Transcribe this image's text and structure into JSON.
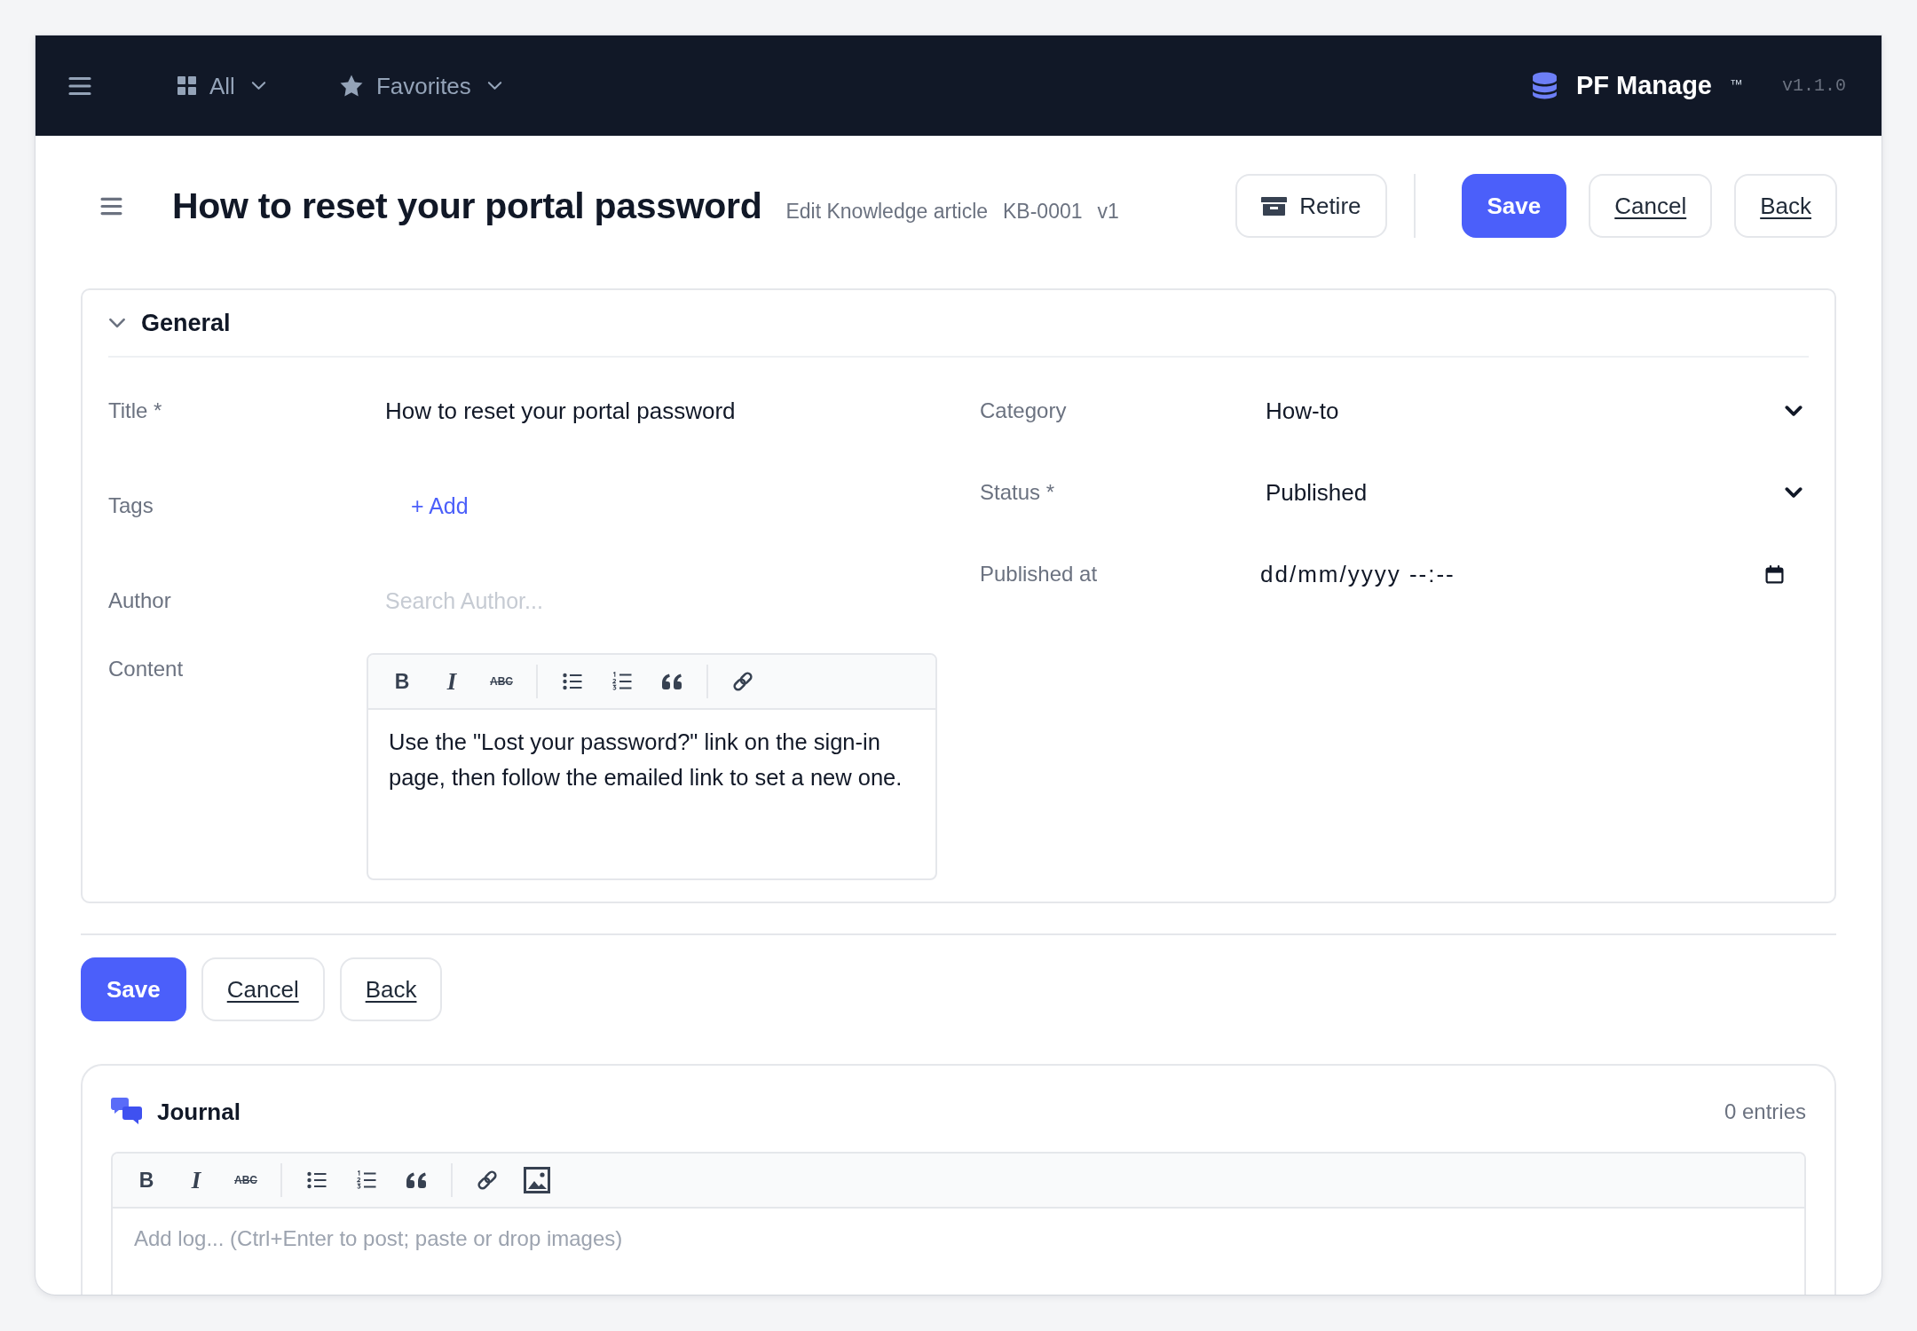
{
  "nav": {
    "links": [
      {
        "label": "All",
        "kind": "apps"
      },
      {
        "label": "Favorites",
        "kind": "favorites"
      }
    ],
    "brand": {
      "name": "PF Manage",
      "mark": "™",
      "version": "v1.1.0"
    }
  },
  "header": {
    "title": "How to reset your portal password",
    "subtitle": [
      "Edit Knowledge article",
      "KB-0001",
      "v1"
    ],
    "tools": [
      {
        "label": "Retire",
        "kind": "retire"
      }
    ],
    "actions": [
      {
        "label": "Save",
        "kind": "save"
      },
      {
        "label": "Cancel",
        "kind": "cancel"
      },
      {
        "label": "Back",
        "kind": "back"
      }
    ]
  },
  "section": {
    "title": "General",
    "expanded": true,
    "left_fields": [
      {
        "label": "Title *",
        "kind": "text",
        "value": "How to reset your portal password"
      },
      {
        "label": "Tags",
        "kind": "tags",
        "action": "+ Add"
      },
      {
        "label": "Author",
        "kind": "search",
        "placeholder": "Search Author..."
      },
      {
        "label": "Content",
        "kind": "richtext",
        "toolbar": [
          {
            "kind": "bold",
            "glyph": "B"
          },
          {
            "kind": "italic",
            "glyph": "I"
          },
          {
            "kind": "strikethrough",
            "glyph": "ABC"
          },
          {
            "kind": "separator"
          },
          {
            "kind": "bullet-list"
          },
          {
            "kind": "numbered-list"
          },
          {
            "kind": "quote"
          },
          {
            "kind": "separator"
          },
          {
            "kind": "link"
          }
        ],
        "value": "Use the \"Lost your password?\" link on the sign-in page, then follow the emailed link to set a new one."
      }
    ],
    "right_fields": [
      {
        "label": "Category",
        "kind": "select",
        "value": "How-to"
      },
      {
        "label": "Status *",
        "kind": "select",
        "value": "Published"
      },
      {
        "label": "Published at",
        "kind": "datetime",
        "value": "dd/mm/yyyy --:--"
      }
    ]
  },
  "form_actions": [
    {
      "label": "Save",
      "kind": "save"
    },
    {
      "label": "Cancel",
      "kind": "cancel"
    },
    {
      "label": "Back",
      "kind": "back"
    }
  ],
  "journal": {
    "title": "Journal",
    "count": "0 entries",
    "toolbar": [
      {
        "kind": "bold",
        "glyph": "B"
      },
      {
        "kind": "italic",
        "glyph": "I"
      },
      {
        "kind": "strikethrough",
        "glyph": "ABC"
      },
      {
        "kind": "separator"
      },
      {
        "kind": "bullet-list"
      },
      {
        "kind": "numbered-list"
      },
      {
        "kind": "quote"
      },
      {
        "kind": "separator"
      },
      {
        "kind": "link"
      },
      {
        "kind": "image"
      }
    ],
    "placeholder": "Add log... (Ctrl+Enter to post; paste or drop images)"
  }
}
